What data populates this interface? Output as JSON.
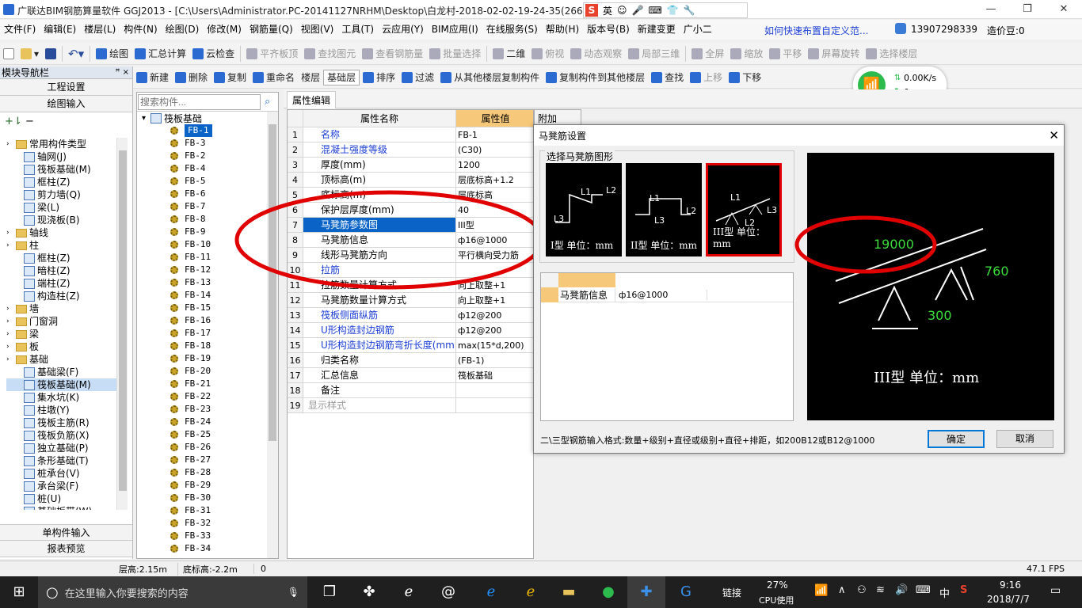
{
  "titlebar": {
    "title": "广联达BIM钢筋算量软件 GGJ2013 - [C:\\Users\\Administrator.PC-20141127NRHM\\Desktop\\白龙村-2018-02-02-19-24-35(2666版).GGJ12]",
    "ime_label": "英",
    "minimize": "—",
    "restore": "❐",
    "close": "✕"
  },
  "menu": [
    "文件(F)",
    "编辑(E)",
    "楼层(L)",
    "构件(N)",
    "绘图(D)",
    "修改(M)",
    "钢筋量(Q)",
    "视图(V)",
    "工具(T)",
    "云应用(Y)",
    "BIM应用(I)",
    "在线服务(S)",
    "帮助(H)",
    "版本号(B)",
    "新建变更",
    "广小二"
  ],
  "menu_right": {
    "link": "如何快速布置自定义范...",
    "phone": "13907298339",
    "beans": "造价豆:0"
  },
  "toolbar1": [
    "绘图",
    "汇总计算",
    "云检查",
    "平齐板顶",
    "查找图元",
    "查看钢筋量",
    "批量选择",
    "二维",
    "俯视",
    "动态观察",
    "局部三维",
    "全屏",
    "缩放",
    "平移",
    "屏幕旋转",
    "选择楼层"
  ],
  "toolbar2": [
    "新建",
    "删除",
    "复制",
    "重命名",
    "楼层",
    "基础层",
    "排序",
    "过滤",
    "从其他楼层复制构件",
    "复制构件到其他楼层",
    "查找",
    "上移",
    "下移"
  ],
  "net": {
    "speed": "0.00K/s",
    "count": "0"
  },
  "nav": {
    "title": "模块导航栏",
    "pin": "ꟸ ×",
    "btn_top": [
      "工程设置",
      "绘图输入"
    ],
    "tree": [
      {
        "label": "常用构件类型",
        "level": 0,
        "type": "folder"
      },
      {
        "label": "轴网(J)",
        "level": 1,
        "type": "comp"
      },
      {
        "label": "筏板基础(M)",
        "level": 1,
        "type": "comp"
      },
      {
        "label": "框柱(Z)",
        "level": 1,
        "type": "comp"
      },
      {
        "label": "剪力墙(Q)",
        "level": 1,
        "type": "comp"
      },
      {
        "label": "梁(L)",
        "level": 1,
        "type": "comp"
      },
      {
        "label": "现浇板(B)",
        "level": 1,
        "type": "comp"
      },
      {
        "label": "轴线",
        "level": 0,
        "type": "folder"
      },
      {
        "label": "柱",
        "level": 0,
        "type": "folder"
      },
      {
        "label": "框柱(Z)",
        "level": 1,
        "type": "comp"
      },
      {
        "label": "暗柱(Z)",
        "level": 1,
        "type": "comp"
      },
      {
        "label": "端柱(Z)",
        "level": 1,
        "type": "comp"
      },
      {
        "label": "构造柱(Z)",
        "level": 1,
        "type": "comp"
      },
      {
        "label": "墙",
        "level": 0,
        "type": "folder"
      },
      {
        "label": "门窗洞",
        "level": 0,
        "type": "folder"
      },
      {
        "label": "梁",
        "level": 0,
        "type": "folder"
      },
      {
        "label": "板",
        "level": 0,
        "type": "folder"
      },
      {
        "label": "基础",
        "level": 0,
        "type": "folder"
      },
      {
        "label": "基础梁(F)",
        "level": 1,
        "type": "comp"
      },
      {
        "label": "筏板基础(M)",
        "level": 1,
        "type": "comp",
        "selected": true
      },
      {
        "label": "集水坑(K)",
        "level": 1,
        "type": "comp"
      },
      {
        "label": "柱墩(Y)",
        "level": 1,
        "type": "comp"
      },
      {
        "label": "筏板主筋(R)",
        "level": 1,
        "type": "comp"
      },
      {
        "label": "筏板负筋(X)",
        "level": 1,
        "type": "comp"
      },
      {
        "label": "独立基础(P)",
        "level": 1,
        "type": "comp"
      },
      {
        "label": "条形基础(T)",
        "level": 1,
        "type": "comp"
      },
      {
        "label": "桩承台(V)",
        "level": 1,
        "type": "comp"
      },
      {
        "label": "承台梁(F)",
        "level": 1,
        "type": "comp"
      },
      {
        "label": "桩(U)",
        "level": 1,
        "type": "comp"
      },
      {
        "label": "基础板带(W)",
        "level": 1,
        "type": "comp"
      }
    ],
    "btn_bottom": [
      "单构件输入",
      "报表预览"
    ]
  },
  "list": {
    "search_placeholder": "搜索构件...",
    "root": "筏板基础",
    "items": [
      "FB-1",
      "FB-3",
      "FB-2",
      "FB-4",
      "FB-5",
      "FB-6",
      "FB-7",
      "FB-8",
      "FB-9",
      "FB-10",
      "FB-11",
      "FB-12",
      "FB-13",
      "FB-14",
      "FB-15",
      "FB-16",
      "FB-17",
      "FB-18",
      "FB-19",
      "FB-20",
      "FB-21",
      "FB-22",
      "FB-23",
      "FB-24",
      "FB-25",
      "FB-26",
      "FB-27",
      "FB-28",
      "FB-29",
      "FB-30",
      "FB-31",
      "FB-32",
      "FB-33",
      "FB-34"
    ]
  },
  "props": {
    "tab": "属性编辑",
    "headers": [
      "属性名称",
      "属性值",
      "附加"
    ],
    "rows": [
      {
        "n": "1",
        "k": "名称",
        "v": "FB-1",
        "blue": true
      },
      {
        "n": "2",
        "k": "混凝土强度等级",
        "v": "(C30)",
        "blue": true
      },
      {
        "n": "3",
        "k": "厚度(mm)",
        "v": "1200"
      },
      {
        "n": "4",
        "k": "顶标高(m)",
        "v": "层底标高+1.2"
      },
      {
        "n": "5",
        "k": "底标高(m)",
        "v": "层底标高"
      },
      {
        "n": "6",
        "k": "保护层厚度(mm)",
        "v": "40"
      },
      {
        "n": "7",
        "k": "马凳筋参数图",
        "v": "III型",
        "sel": true
      },
      {
        "n": "8",
        "k": "马凳筋信息",
        "v": "ф16@1000"
      },
      {
        "n": "9",
        "k": "线形马凳筋方向",
        "v": "平行横向受力筋"
      },
      {
        "n": "10",
        "k": "拉筋",
        "v": "",
        "blue": true
      },
      {
        "n": "11",
        "k": "拉筋数量计算方式",
        "v": "向上取整+1"
      },
      {
        "n": "12",
        "k": "马凳筋数量计算方式",
        "v": "向上取整+1"
      },
      {
        "n": "13",
        "k": "筏板侧面纵筋",
        "v": "ф12@200",
        "blue": true
      },
      {
        "n": "14",
        "k": "U形构造封边钢筋",
        "v": "ф12@200",
        "blue": true
      },
      {
        "n": "15",
        "k": "U形构造封边钢筋弯折长度(mm)",
        "v": "max(15*d,200)",
        "blue": true
      },
      {
        "n": "16",
        "k": "归类名称",
        "v": "(FB-1)"
      },
      {
        "n": "17",
        "k": "汇总信息",
        "v": "筏板基础"
      },
      {
        "n": "18",
        "k": "备注",
        "v": ""
      },
      {
        "n": "19",
        "k": "显示样式",
        "v": "",
        "grey": true
      }
    ]
  },
  "dialog": {
    "title": "马凳筋设置",
    "group": "选择马凳筋图形",
    "shapes": [
      {
        "cap": "I型 单位：mm",
        "l1": "L1",
        "l2": "L2",
        "l3": "L3"
      },
      {
        "cap": "II型 单位：mm",
        "l1": "L1",
        "l2": "L2",
        "l3": "L3"
      },
      {
        "cap": "III型 单位：mm",
        "l1": "L1",
        "l2": "L2",
        "l3": "L3",
        "selected": true
      }
    ],
    "grid_label": "马凳筋信息",
    "grid_value": "ф16@1000",
    "preview": {
      "l1": "19000",
      "l3": "760",
      "l2": "300",
      "cap": "III型 单位：mm"
    },
    "hint": "二\\三型钢筋输入格式:数量+级别+直径或级别+直径+排距，如200B12或B12@1000",
    "ok": "确定",
    "cancel": "取消"
  },
  "status": {
    "floor_h": "层高:2.15m",
    "base_h": "底标高:-2.2m",
    "zero": "0",
    "fps": "47.1 FPS"
  },
  "taskbar": {
    "search": "在这里输入你要搜索的内容",
    "link": "链接",
    "cpu_pct": "27%",
    "cpu": "CPU使用",
    "lang": "中",
    "time": "9:16",
    "date": "2018/7/7"
  },
  "colors": {
    "annotation": "#e00000",
    "selected_row": "#0a64c8",
    "header_orange": "#f5c87a"
  }
}
